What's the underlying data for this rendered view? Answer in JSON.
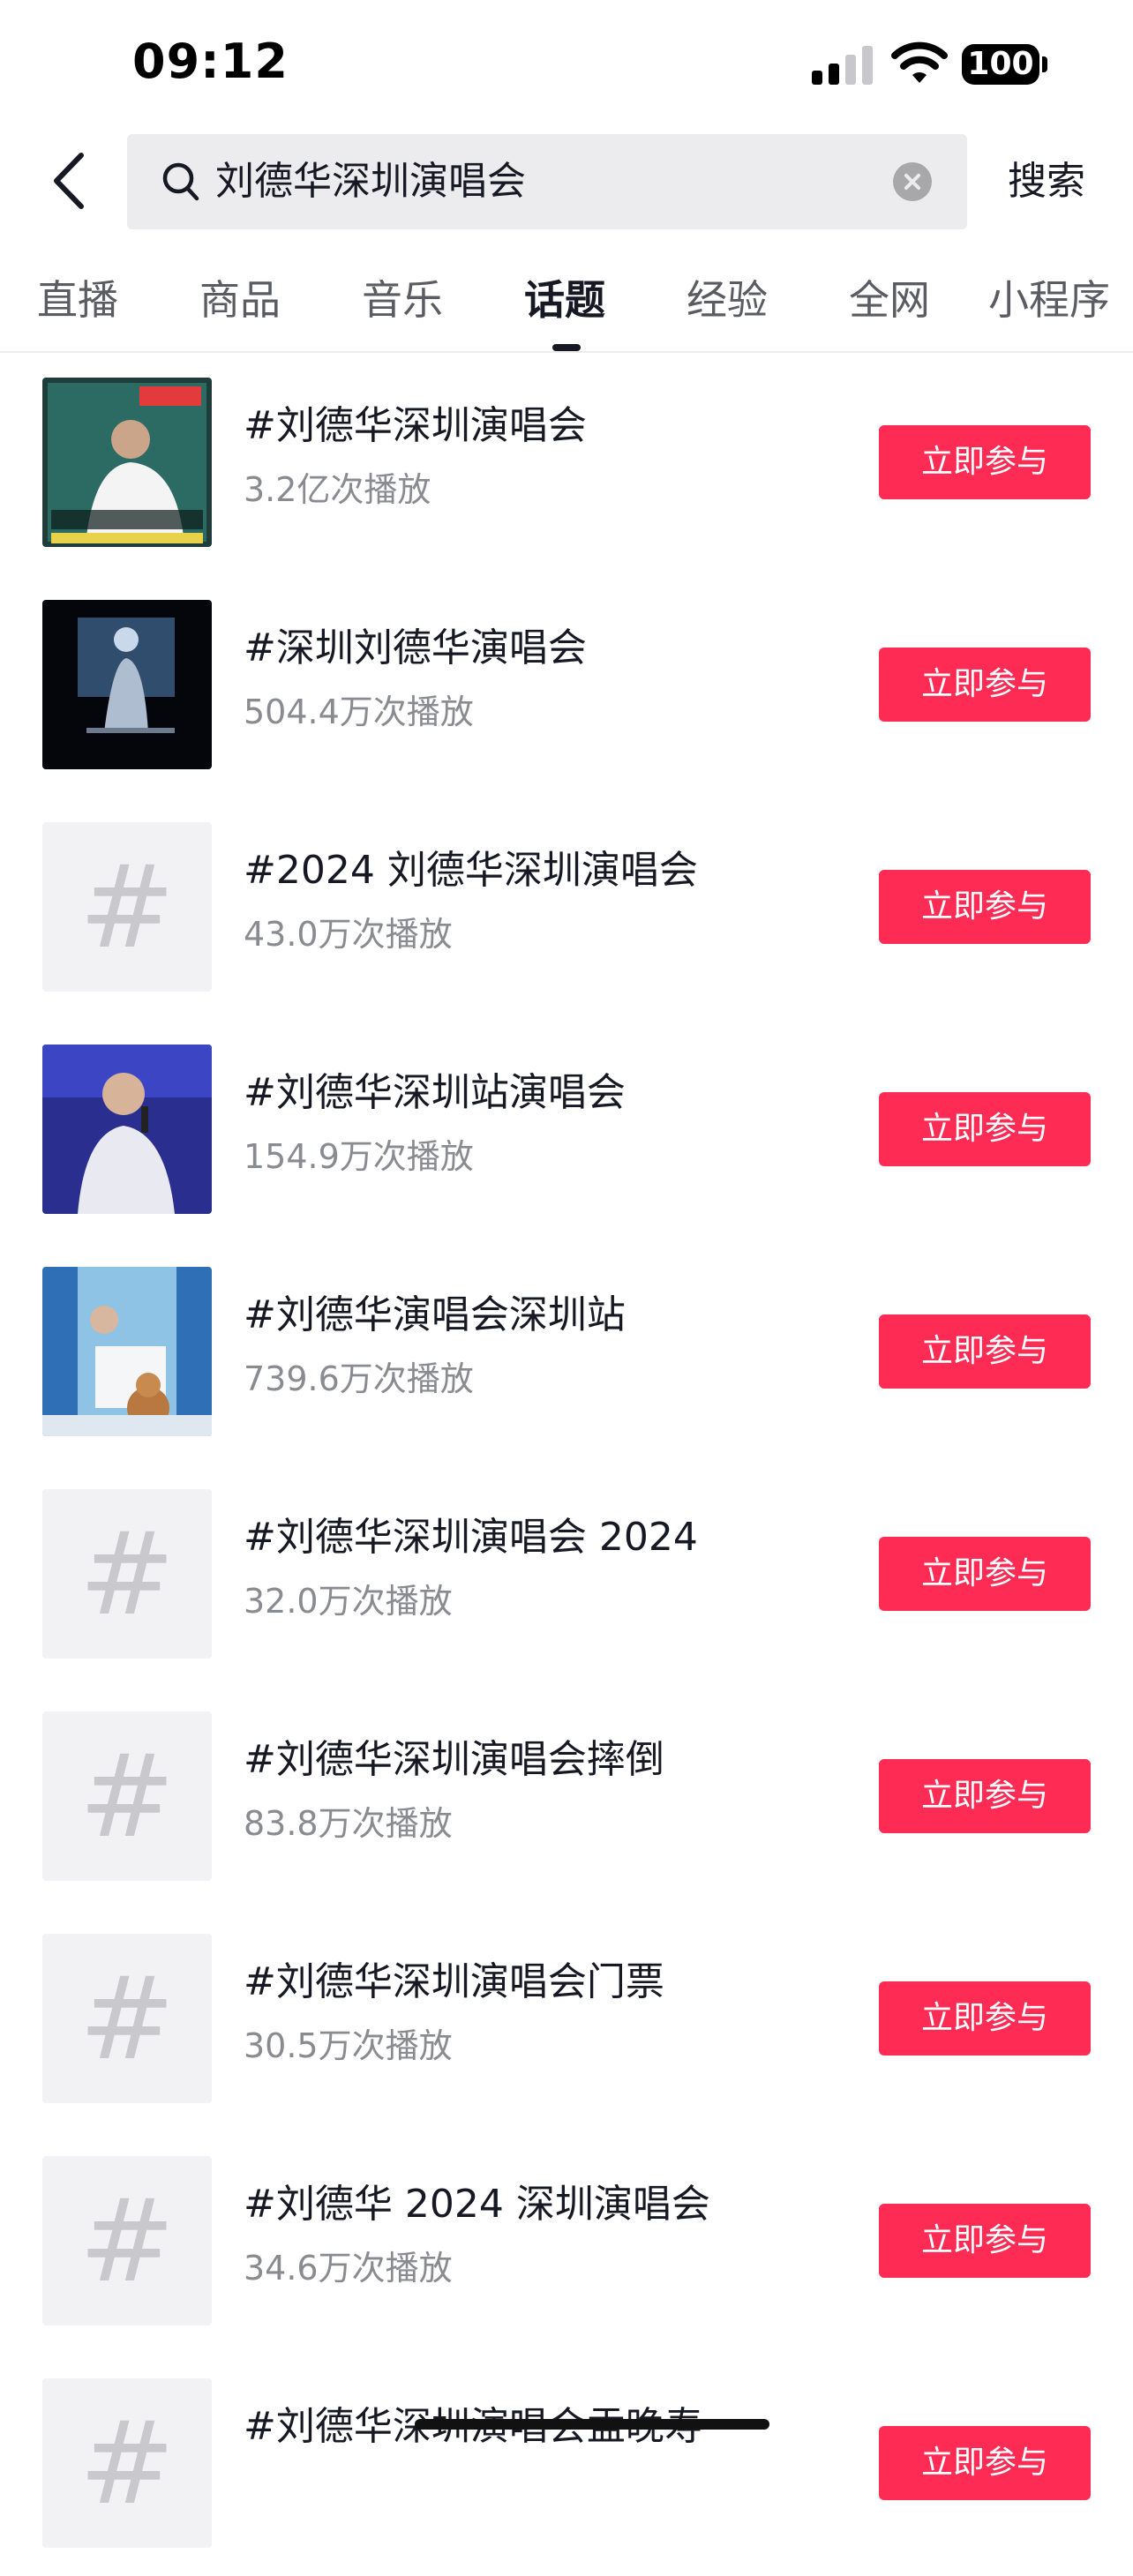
{
  "status_bar": {
    "time": "09:12",
    "battery": "100"
  },
  "search": {
    "query": "刘德华深圳演唱会",
    "button_label": "搜索"
  },
  "tabs": [
    {
      "label": "直播",
      "active": false
    },
    {
      "label": "商品",
      "active": false
    },
    {
      "label": "音乐",
      "active": false
    },
    {
      "label": "话题",
      "active": true
    },
    {
      "label": "经验",
      "active": false
    },
    {
      "label": "全网",
      "active": false
    },
    {
      "label": "小程序",
      "active": false
    }
  ],
  "topics": [
    {
      "title": "#刘德华深圳演唱会",
      "plays": "3.2亿次播放",
      "button": "立即参与",
      "thumb": "photo"
    },
    {
      "title": "#深圳刘德华演唱会",
      "plays": "504.4万次播放",
      "button": "立即参与",
      "thumb": "photo"
    },
    {
      "title": "#2024 刘德华深圳演唱会",
      "plays": "43.0万次播放",
      "button": "立即参与",
      "thumb": "hash"
    },
    {
      "title": "#刘德华深圳站演唱会",
      "plays": "154.9万次播放",
      "button": "立即参与",
      "thumb": "photo"
    },
    {
      "title": "#刘德华演唱会深圳站",
      "plays": "739.6万次播放",
      "button": "立即参与",
      "thumb": "photo"
    },
    {
      "title": "#刘德华深圳演唱会 2024",
      "plays": "32.0万次播放",
      "button": "立即参与",
      "thumb": "hash"
    },
    {
      "title": "#刘德华深圳演唱会摔倒",
      "plays": "83.8万次播放",
      "button": "立即参与",
      "thumb": "hash"
    },
    {
      "title": "#刘德华深圳演唱会门票",
      "plays": "30.5万次播放",
      "button": "立即参与",
      "thumb": "hash"
    },
    {
      "title": "#刘德华 2024 深圳演唱会",
      "plays": "34.6万次播放",
      "button": "立即参与",
      "thumb": "hash"
    },
    {
      "title": "#刘德华深圳演唱会盂晚寿",
      "plays": "",
      "button": "立即参与",
      "thumb": "hash"
    }
  ],
  "thumb_hash_glyph": "#",
  "colors": {
    "accent": "#fe2c55",
    "text": "#161823",
    "muted": "#8a8b91"
  }
}
